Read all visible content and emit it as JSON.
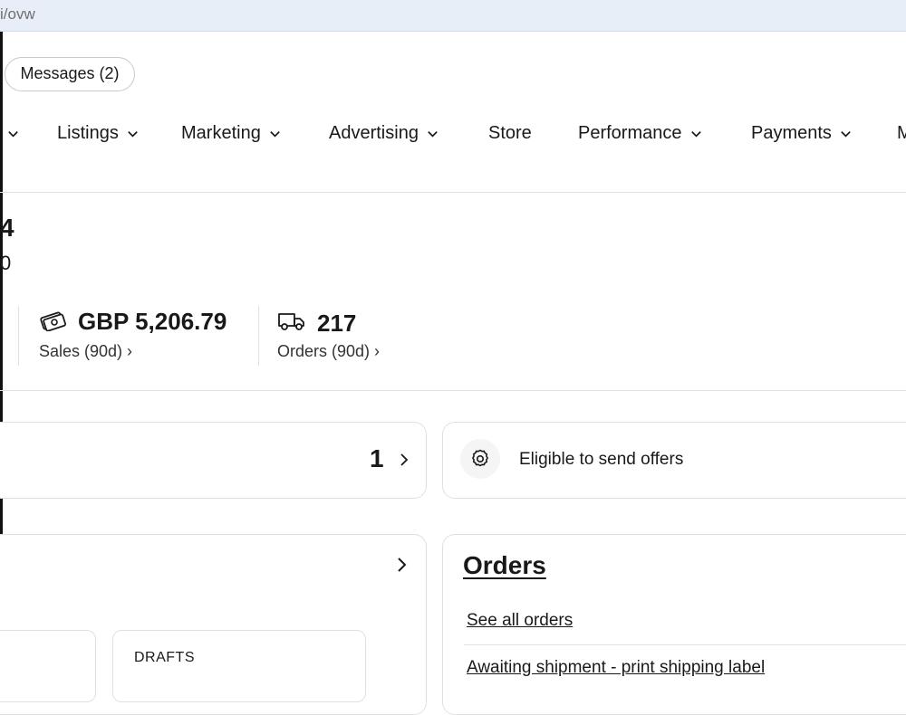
{
  "browser": {
    "url_fragment": "i/ovw"
  },
  "header": {
    "messages_label": "Messages (2)"
  },
  "nav": {
    "items": [
      {
        "label": "Listings"
      },
      {
        "label": "Marketing"
      },
      {
        "label": "Advertising"
      },
      {
        "label": "Store"
      },
      {
        "label": "Performance"
      },
      {
        "label": "Payments"
      },
      {
        "label": "M"
      }
    ]
  },
  "summary": {
    "partial_value": "4",
    "partial_sub": "0"
  },
  "stats": [
    {
      "value": "GBP 5,206.79",
      "label": "Sales (90d) ›",
      "icon": "money-icon"
    },
    {
      "value": "217",
      "label": "Orders (90d) ›",
      "icon": "truck-icon"
    }
  ],
  "tasks": {
    "count": "1",
    "offers_label": "Eligible to send offers",
    "offers_icon": "gear-icon"
  },
  "orders": {
    "title": "Orders",
    "see_all": "See all orders",
    "awaiting": "Awaiting shipment - print shipping label"
  },
  "listings": {
    "drafts_label": "DRAFTS"
  }
}
